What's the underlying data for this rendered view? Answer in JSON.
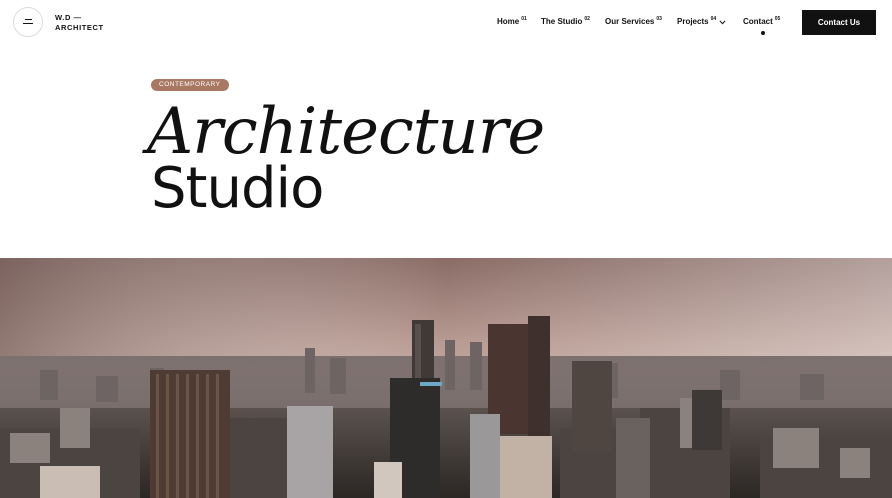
{
  "brand": {
    "line1": "W.D —",
    "line2": "ARCHITECT"
  },
  "nav": {
    "items": [
      {
        "label": "Home",
        "num": "01"
      },
      {
        "label": "The Studio",
        "num": "02"
      },
      {
        "label": "Our Services",
        "num": "03"
      },
      {
        "label": "Projects",
        "num": "04"
      },
      {
        "label": "Contact",
        "num": "05"
      }
    ],
    "active": "Contact",
    "cta": "Contact Us"
  },
  "hero": {
    "badge": "CONTEMPORARY",
    "title_italic": "Architecture",
    "title_bold": "Studio"
  },
  "icons": {
    "menu": "menu-icon",
    "projects_dropdown": "chevron-down-icon"
  },
  "colors": {
    "accent": "#a97862",
    "dark": "#111111",
    "background": "#ffffff"
  }
}
